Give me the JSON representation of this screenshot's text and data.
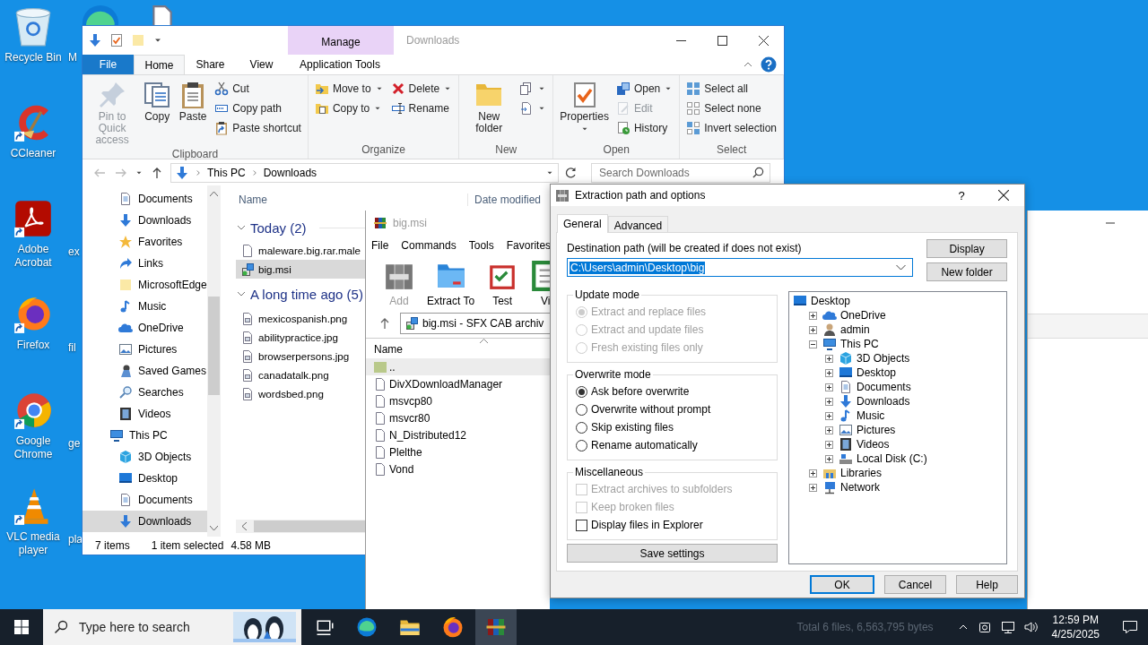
{
  "desktop": {
    "icons": [
      {
        "label": "Recycle Bin",
        "kind": "bin"
      },
      {
        "label": "CCleaner",
        "kind": "ccleaner"
      },
      {
        "label": "Adobe Acrobat",
        "kind": "acrobat"
      },
      {
        "label": "Firefox",
        "kind": "firefox"
      },
      {
        "label": "Google Chrome",
        "kind": "chrome"
      },
      {
        "label": "VLC media player",
        "kind": "vlc"
      }
    ],
    "partial_labels": [
      "M",
      "ex",
      "fil",
      "ge",
      "pla"
    ]
  },
  "explorer": {
    "title": "Downloads",
    "context_tab": "Manage",
    "tabs": [
      {
        "label": "File",
        "kind": "menu",
        "selected": false
      },
      {
        "label": "Home",
        "kind": "tab",
        "selected": true
      },
      {
        "label": "Share",
        "kind": "tab",
        "selected": false
      },
      {
        "label": "View",
        "kind": "tab",
        "selected": false
      },
      {
        "label": "Application Tools",
        "kind": "contextual",
        "selected": false
      }
    ],
    "ribbon": [
      {
        "label": "Clipboard",
        "columns": [
          [
            {
              "label": "Pin to Quick access",
              "large": true,
              "kind": "pin",
              "disabled": true,
              "dropdown": false
            }
          ],
          [
            {
              "label": "Copy",
              "large": true,
              "kind": "copy",
              "disabled": false,
              "dropdown": false
            }
          ],
          [
            {
              "label": "Paste",
              "large": true,
              "kind": "paste",
              "disabled": false,
              "dropdown": false
            }
          ],
          [
            {
              "label": "Cut",
              "large": false,
              "kind": "scissors",
              "disabled": false,
              "dropdown": false
            },
            {
              "label": "Copy path",
              "large": false,
              "kind": "path",
              "disabled": false,
              "dropdown": false
            },
            {
              "label": "Paste shortcut",
              "large": false,
              "kind": "shortcut",
              "disabled": false,
              "dropdown": false
            }
          ]
        ]
      },
      {
        "label": "Organize",
        "columns": [
          [
            {
              "label": "Move to",
              "large": false,
              "kind": "moveto",
              "disabled": false,
              "dropdown": true
            },
            {
              "label": "Copy to",
              "large": false,
              "kind": "copyto",
              "disabled": false,
              "dropdown": true
            }
          ],
          [
            {
              "label": "Delete",
              "large": false,
              "kind": "delete",
              "disabled": false,
              "dropdown": true
            },
            {
              "label": "Rename",
              "large": false,
              "kind": "rename",
              "disabled": false,
              "dropdown": false
            }
          ]
        ]
      },
      {
        "label": "New",
        "columns": [
          [
            {
              "label": "New folder",
              "large": true,
              "kind": "folder",
              "disabled": false,
              "dropdown": false
            }
          ],
          [
            {
              "large": false,
              "kind": "newitem",
              "disabled": false,
              "dropdown": true
            },
            {
              "large": false,
              "kind": "easyaccess",
              "disabled": false,
              "dropdown": true
            }
          ]
        ]
      },
      {
        "label": "Open",
        "columns": [
          [
            {
              "label": "Properties",
              "large": true,
              "kind": "properties",
              "disabled": false,
              "dropdown": true
            }
          ],
          [
            {
              "label": "Open",
              "large": false,
              "kind": "open",
              "disabled": false,
              "dropdown": true
            },
            {
              "label": "Edit",
              "large": false,
              "kind": "edit",
              "disabled": true,
              "dropdown": false
            },
            {
              "label": "History",
              "large": false,
              "kind": "history",
              "disabled": false,
              "dropdown": false
            }
          ]
        ]
      },
      {
        "label": "Select",
        "columns": [
          [
            {
              "label": "Select all",
              "large": false,
              "kind": "selectall",
              "disabled": false,
              "dropdown": false
            },
            {
              "label": "Select none",
              "large": false,
              "kind": "selectnone",
              "disabled": false,
              "dropdown": false
            },
            {
              "label": "Invert selection",
              "large": false,
              "kind": "invert",
              "disabled": false,
              "dropdown": false
            }
          ]
        ]
      }
    ],
    "path": [
      "This PC",
      "Downloads"
    ],
    "search_placeholder": "Search Downloads",
    "nav": [
      {
        "label": "Documents",
        "kind": "documents",
        "selected": false
      },
      {
        "label": "Downloads",
        "kind": "downloads",
        "selected": false
      },
      {
        "label": "Favorites",
        "kind": "star",
        "selected": false
      },
      {
        "label": "Links",
        "kind": "link",
        "selected": false
      },
      {
        "label": "MicrosoftEdge",
        "kind": "plainfolder",
        "selected": false
      },
      {
        "label": "Music",
        "kind": "music",
        "selected": false
      },
      {
        "label": "OneDrive",
        "kind": "cloud",
        "selected": false
      },
      {
        "label": "Pictures",
        "kind": "pictures",
        "selected": false
      },
      {
        "label": "Saved Games",
        "kind": "game",
        "selected": false
      },
      {
        "label": "Searches",
        "kind": "search",
        "selected": false
      },
      {
        "label": "Videos",
        "kind": "film",
        "selected": false
      },
      {
        "label": "This PC",
        "kind": "pc",
        "selected": false,
        "children": [
          {
            "label": "3D Objects",
            "kind": "cube",
            "selected": false
          },
          {
            "label": "Desktop",
            "kind": "desktop",
            "selected": false
          },
          {
            "label": "Documents",
            "kind": "documents",
            "selected": false
          },
          {
            "label": "Downloads",
            "kind": "downloads",
            "selected": true
          }
        ]
      }
    ],
    "columns": [
      "Name",
      "Date modified"
    ],
    "groups": [
      {
        "label": "Today (2)",
        "expanded": true,
        "files": [
          {
            "name": "maleware.big.rar.male",
            "kind": "blank",
            "selected": false
          },
          {
            "name": "big.msi",
            "kind": "msi",
            "selected": true
          }
        ]
      },
      {
        "label": "A long time ago (5)",
        "expanded": true,
        "files": [
          {
            "name": "mexicospanish.png",
            "kind": "image",
            "selected": false
          },
          {
            "name": "abilitypractice.jpg",
            "kind": "image",
            "selected": false
          },
          {
            "name": "browserpersons.jpg",
            "kind": "image",
            "selected": false
          },
          {
            "name": "canadatalk.png",
            "kind": "image",
            "selected": false
          },
          {
            "name": "wordsbed.png",
            "kind": "image",
            "selected": false
          }
        ]
      }
    ],
    "status": [
      "7 items",
      "1 item selected",
      "4.58 MB"
    ]
  },
  "winrar": {
    "title": "big.msi",
    "menu": [
      "File",
      "Commands",
      "Tools",
      "Favorites"
    ],
    "toolbar": [
      {
        "label": "Add",
        "kind": "add",
        "disabled": true
      },
      {
        "label": "Extract To",
        "kind": "extract",
        "disabled": false
      },
      {
        "label": "Test",
        "kind": "test",
        "disabled": false
      },
      {
        "label": "Vi",
        "kind": "view",
        "disabled": false
      }
    ],
    "path": "big.msi - SFX CAB archiv",
    "column": "Name",
    "files": [
      {
        "name": "..",
        "kind": "parent",
        "selected": true
      },
      {
        "name": "DivXDownloadManager",
        "kind": "blank",
        "selected": false
      },
      {
        "name": "msvcp80",
        "kind": "blank",
        "selected": false
      },
      {
        "name": "msvcr80",
        "kind": "blank",
        "selected": false
      },
      {
        "name": "N_Distributed12",
        "kind": "blank",
        "selected": false
      },
      {
        "name": "Plelthe",
        "kind": "blank",
        "selected": false
      },
      {
        "name": "Vond",
        "kind": "blank",
        "selected": false
      }
    ],
    "status_bar": "Total 6 files, 6,563,795 bytes"
  },
  "dialog": {
    "title": "Extraction path and options",
    "help_button": "?",
    "tabs": [
      {
        "label": "General",
        "selected": true
      },
      {
        "label": "Advanced",
        "selected": false
      }
    ],
    "path_label": "Destination path (will be created if does not exist)",
    "path": "C:\\Users\\admin\\Desktop\\big",
    "side_buttons": [
      "Display",
      "New folder"
    ],
    "groups": [
      {
        "label": "Update mode",
        "options": [
          {
            "label": "Extract and replace files",
            "kind": "radio",
            "checked": true,
            "disabled": true
          },
          {
            "label": "Extract and update files",
            "kind": "radio",
            "checked": false,
            "disabled": true
          },
          {
            "label": "Fresh existing files only",
            "kind": "radio",
            "checked": false,
            "disabled": true
          }
        ]
      },
      {
        "label": "Overwrite mode",
        "options": [
          {
            "label": "Ask before overwrite",
            "kind": "radio",
            "checked": true,
            "disabled": false
          },
          {
            "label": "Overwrite without prompt",
            "kind": "radio",
            "checked": false,
            "disabled": false
          },
          {
            "label": "Skip existing files",
            "kind": "radio",
            "checked": false,
            "disabled": false
          },
          {
            "label": "Rename automatically",
            "kind": "radio",
            "checked": false,
            "disabled": false
          }
        ]
      },
      {
        "label": "Miscellaneous",
        "options": [
          {
            "label": "Extract archives to subfolders",
            "kind": "checkbox",
            "checked": false,
            "disabled": true
          },
          {
            "label": "Keep broken files",
            "kind": "checkbox",
            "checked": false,
            "disabled": true
          },
          {
            "label": "Display files in Explorer",
            "kind": "checkbox",
            "checked": false,
            "disabled": false
          }
        ]
      }
    ],
    "save_button": "Save settings",
    "tree": [
      {
        "label": "Desktop",
        "kind": "desktop",
        "children": [
          {
            "label": "OneDrive",
            "kind": "cloud",
            "expanded": false
          },
          {
            "label": "admin",
            "kind": "user",
            "expanded": false
          },
          {
            "label": "This PC",
            "kind": "pc",
            "expanded": true,
            "children": [
              {
                "label": "3D Objects",
                "kind": "cube",
                "expanded": false
              },
              {
                "label": "Desktop",
                "kind": "desktop",
                "expanded": false
              },
              {
                "label": "Documents",
                "kind": "documents",
                "expanded": false
              },
              {
                "label": "Downloads",
                "kind": "downloads",
                "expanded": false
              },
              {
                "label": "Music",
                "kind": "music",
                "expanded": false
              },
              {
                "label": "Pictures",
                "kind": "pictures",
                "expanded": false
              },
              {
                "label": "Videos",
                "kind": "film",
                "expanded": false
              },
              {
                "label": "Local Disk (C:)",
                "kind": "disk",
                "expanded": false
              }
            ]
          },
          {
            "label": "Libraries",
            "kind": "libraries",
            "expanded": false
          },
          {
            "label": "Network",
            "kind": "network",
            "expanded": false
          }
        ]
      }
    ],
    "buttons": [
      {
        "label": "OK",
        "default": true
      },
      {
        "label": "Cancel",
        "default": false
      },
      {
        "label": "Help",
        "default": false
      }
    ]
  },
  "taskbar": {
    "search_placeholder": "Type here to search",
    "apps": [
      {
        "kind": "taskview",
        "active": false
      },
      {
        "kind": "edge",
        "active": false
      },
      {
        "kind": "explorer",
        "active": false
      },
      {
        "kind": "firefox",
        "active": false
      },
      {
        "kind": "winrar",
        "active": true
      }
    ],
    "time": "12:59 PM",
    "date": "4/25/2025"
  }
}
